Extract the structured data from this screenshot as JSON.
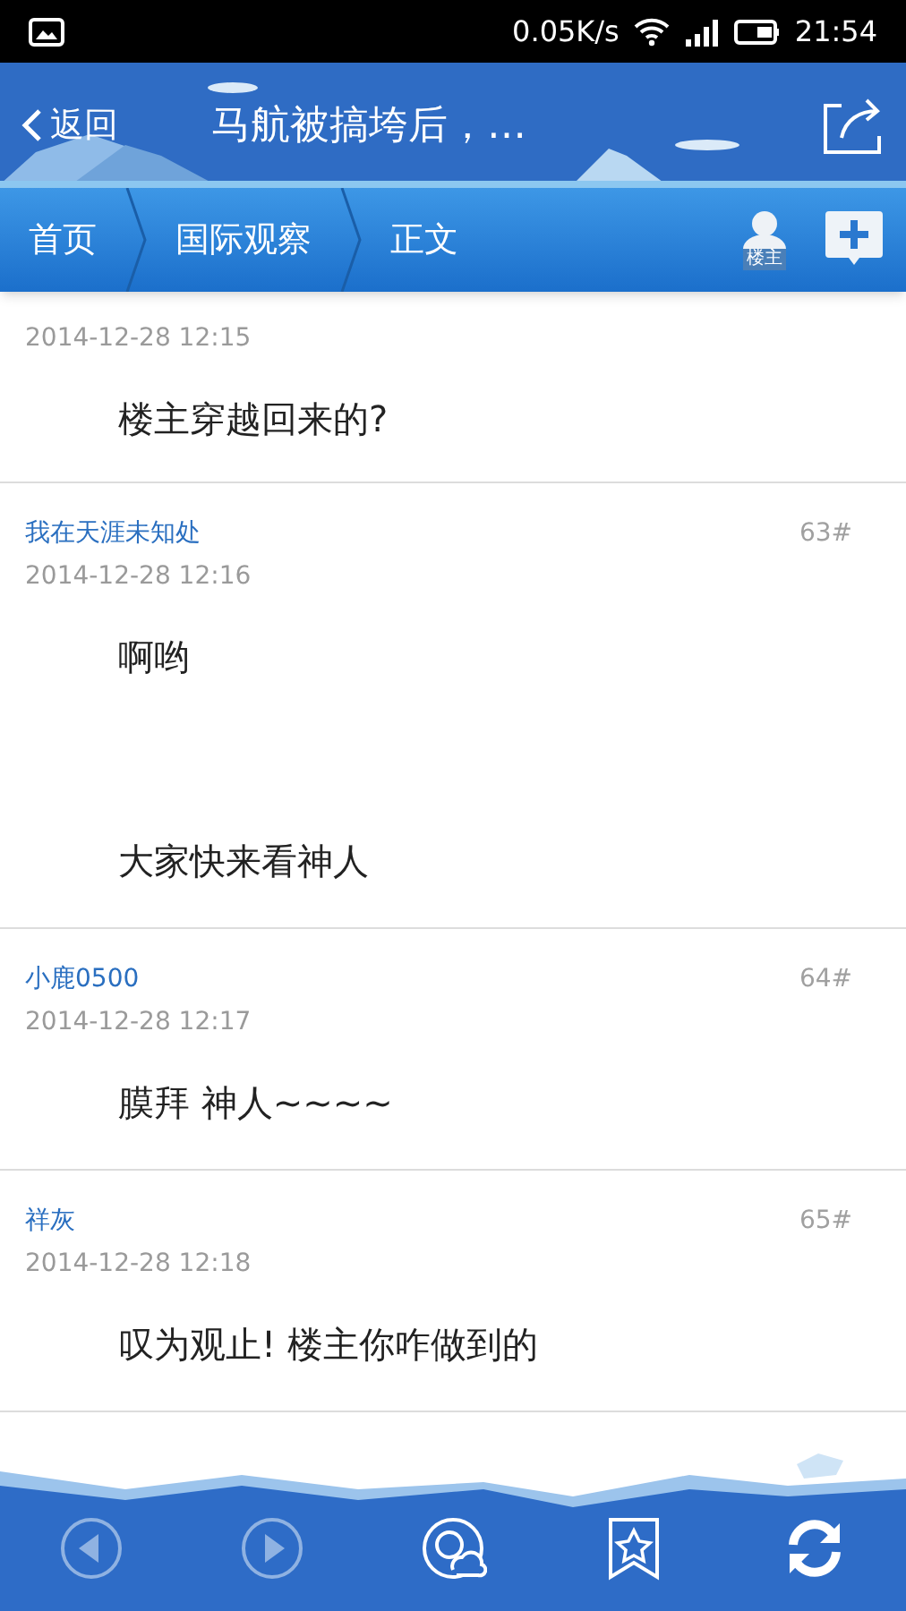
{
  "status_bar": {
    "speed": "0.05K/s",
    "time": "21:54"
  },
  "title_bar": {
    "back": "返回",
    "title": "马航被搞垮后，…"
  },
  "breadcrumb": [
    {
      "label": "首页"
    },
    {
      "label": "国际观察"
    },
    {
      "label": "正文"
    }
  ],
  "author_button": {
    "label": "楼主"
  },
  "posts": [
    {
      "date": "2014-12-28 12:15",
      "content": [
        "楼主穿越回来的?"
      ]
    },
    {
      "author": "我在天涯未知处",
      "floor": "63#",
      "date": "2014-12-28 12:16",
      "content": [
        "啊哟",
        "大家快来看神人"
      ]
    },
    {
      "author": "小鹿0500",
      "floor": "64#",
      "date": "2014-12-28 12:17",
      "content": [
        "膜拜 神人~~~~"
      ]
    },
    {
      "author": "祥灰",
      "floor": "65#",
      "date": "2014-12-28 12:18",
      "content": [
        "叹为观止! 楼主你咋做到的"
      ]
    }
  ],
  "toolbar": [
    {
      "kind": "previous",
      "disabled": true
    },
    {
      "kind": "next",
      "disabled": true
    },
    {
      "kind": "search",
      "disabled": false
    },
    {
      "kind": "bookmark",
      "disabled": false
    },
    {
      "kind": "refresh",
      "disabled": false
    }
  ]
}
